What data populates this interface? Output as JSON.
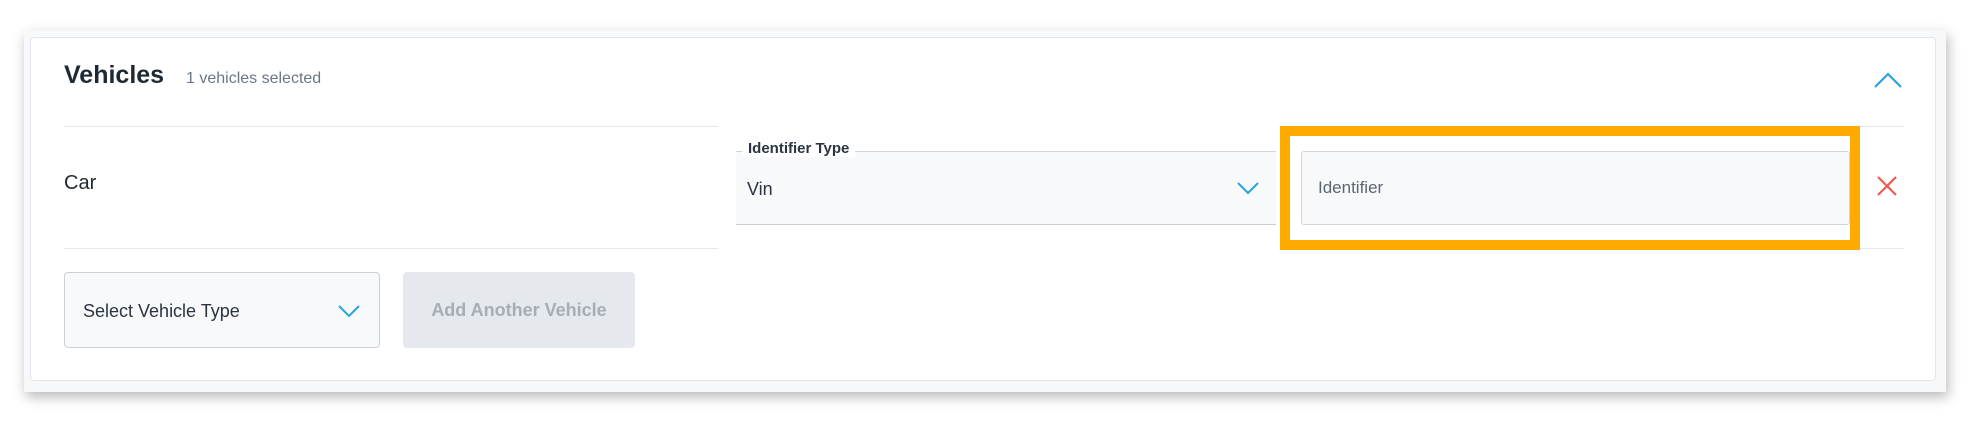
{
  "section": {
    "title": "Vehicles",
    "selected_count_text": "1 vehicles selected",
    "collapse_icon": "chevron-up-icon"
  },
  "vehicle_rows": [
    {
      "name": "Car",
      "identifier_type": {
        "label": "Identifier Type",
        "value": "Vin",
        "icon": "chevron-down-icon"
      },
      "identifier": {
        "value": "",
        "placeholder": "Identifier"
      },
      "remove_icon": "close-icon"
    }
  ],
  "add_vehicle": {
    "select_placeholder": "Select Vehicle Type",
    "select_icon": "chevron-down-icon",
    "button_label": "Add Another Vehicle",
    "button_disabled": true
  },
  "colors": {
    "accent_blue": "#2aa3e0",
    "remove_red": "#ee5a54",
    "highlight_orange": "#ffaa00",
    "disabled_button_bg": "#e5e8ec",
    "disabled_button_text": "#a5adb7"
  }
}
